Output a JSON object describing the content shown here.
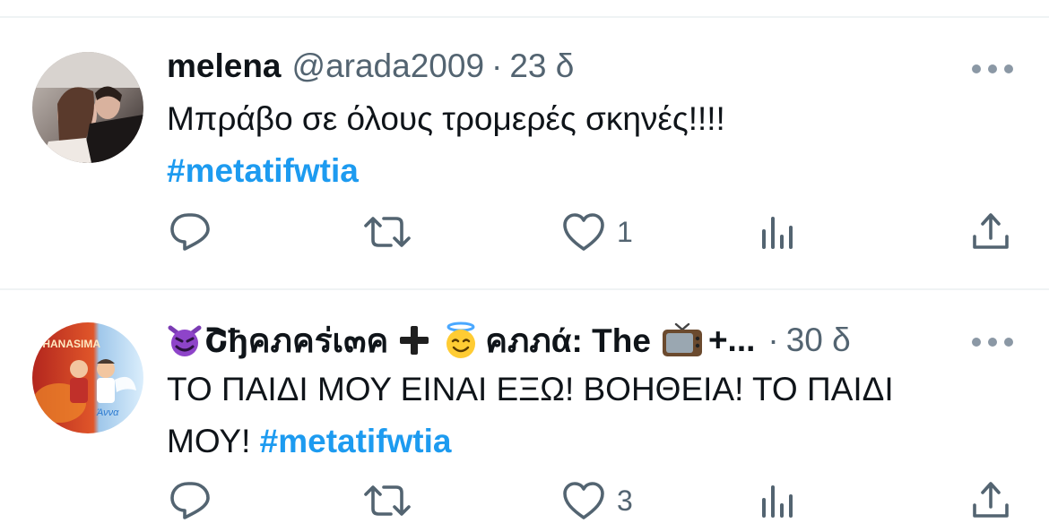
{
  "tweets": [
    {
      "name": "melena",
      "handle": "@arada2009",
      "separator": "·",
      "time": "23 δ",
      "text": "Μπράβο σε όλους τρομερές σκηνές!!!!",
      "hashtag": "#metatifwtia",
      "reply_count": "",
      "retweet_count": "",
      "like_count": "1",
      "views_count": ""
    },
    {
      "name_part1": "Շђคภคร่เ๓ค",
      "name_part2": "คภภά: The",
      "name_ellipsis": "+...",
      "separator": "·",
      "time": "30 δ",
      "text_line1": "ΤΟ ΠΑΙΔΙ ΜΟΥ ΕΙΝΑΙ ΕΞΩ! ΒΟΗΘΕΙΑ! ΤΟ ΠΑΙΔΙ",
      "text_line2": "ΜΟΥ!",
      "hashtag": "#metatifwtia",
      "like_count": "3",
      "avatar_text_top": "THANASIMA",
      "avatar_text_bottom": "Άννα"
    }
  ],
  "colors": {
    "accent": "#1d9bf0",
    "muted": "#536471",
    "divider": "#eff3f4"
  },
  "icons": [
    "reply-icon",
    "retweet-icon",
    "like-icon",
    "views-icon",
    "share-icon",
    "more-icon",
    "devil-emoji",
    "plus-emoji",
    "angel-emoji",
    "tv-emoji"
  ]
}
